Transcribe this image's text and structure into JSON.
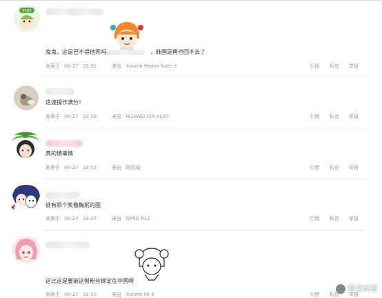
{
  "comments": [
    {
      "text": "鬼鬼，这是巴不得他死吗",
      "text_tail": "，韩国是再也回不去了",
      "meta_prefix": "发表于",
      "date": "06-27",
      "time": "20:31",
      "from_label": "来自",
      "device": "Xiaomi  Redmi  Note  3"
    },
    {
      "text": "这波操作满分！",
      "meta_prefix": "发表于",
      "date": "06-27",
      "time": "20:18",
      "from_label": "来自",
      "device": "HUAWEI  LYA-AL00"
    },
    {
      "text": "真的慎事情",
      "meta_prefix": "发表于",
      "date": "06-27",
      "time": "19:53",
      "from_label": "来自",
      "device": "网页端"
    },
    {
      "text": "谁有那个笑着鞠躬的图",
      "meta_prefix": "发表于",
      "date": "06-27",
      "time": "19:37",
      "from_label": "来自",
      "device": "OPPO  R11"
    },
    {
      "text": "这比这是要被这帮粉丝绑定在中国啊",
      "meta_prefix": "发表于",
      "date": "06-27",
      "time": "19:10",
      "from_label": "来自",
      "device": "Xiaomi  MI  6"
    }
  ],
  "actions": {
    "quote": "引用",
    "message": "私信",
    "report": "举报"
  },
  "avatar_badge": "FUO",
  "watermark": "悟空问答"
}
